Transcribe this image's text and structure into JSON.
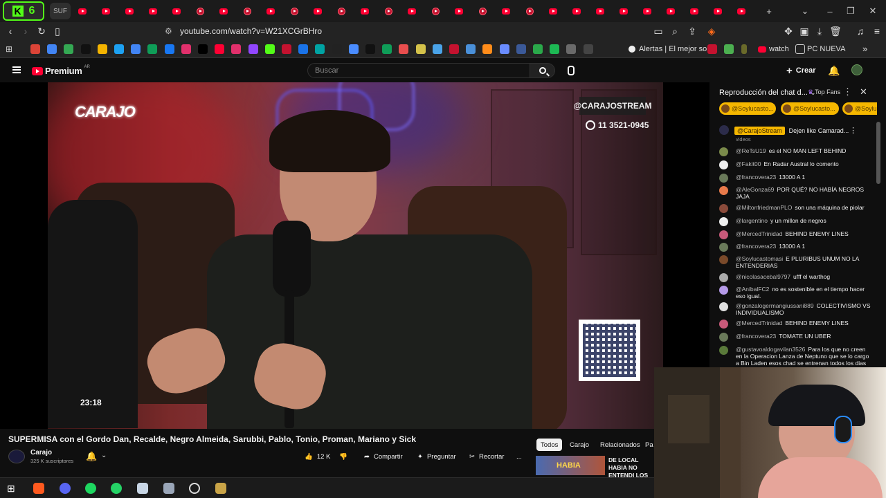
{
  "browser": {
    "kick_ext": {
      "letter": "K",
      "count": "6"
    },
    "active_tab_label": "SUF",
    "tab_favicon_count": 29,
    "url": "youtube.com/watch?v=W21XCGrBHro",
    "bookmarks": {
      "alertas": "Alertas | El mejor so...",
      "watch": "watch",
      "pc_nueva": "PC NUEVA"
    }
  },
  "youtube": {
    "logo_word": "Premium",
    "country": "AR",
    "search_placeholder": "Buscar",
    "create_label": "Crear"
  },
  "video": {
    "overlay_logo": "CARAJO",
    "handle_tag": "@CARAJOSTREAM",
    "phone_tag": "11 3521-0945",
    "timer": "23:18",
    "title": "SUPERMISA con el Gordo Dan, Recalde, Negro Almeida, Sarubbi, Pablo, Tonio, Proman, Mariano y Sick",
    "channel": "Carajo",
    "subscribers": "325 K suscriptores",
    "likes": "12 K",
    "share": "Compartir",
    "ask": "Preguntar",
    "clip": "Recortar",
    "more": "..."
  },
  "filters": [
    "Todos",
    "Carajo",
    "Relacionados",
    "Pa"
  ],
  "recommended": {
    "title": "DE LOCAL HABIA NO ENTENDI LOS",
    "thumb_text": "HABIA"
  },
  "chat": {
    "title": "Reproducción del chat d...",
    "top_fans": "Top Fans",
    "pills": [
      "@Soylucasto...",
      "@Soylucasto...",
      "@Soylu"
    ],
    "pinned": {
      "author": "@CarajoStream",
      "text": "Dejen like Camarad..."
    },
    "partial_word": "videos",
    "messages": [
      {
        "author": "@ReTsU19",
        "text": "es el NO MAN LEFT BEHIND",
        "color": "#7a8a4a"
      },
      {
        "author": "@Fakit00",
        "text": "En Radar Austral lo comento",
        "color": "#eeeeee"
      },
      {
        "author": "@francovera23",
        "text": "13000 A 1",
        "color": "#6a7a5a"
      },
      {
        "author": "@AleGonza69",
        "text": "POR QUÉ? NO HABÍA NEGROS JAJA",
        "color": "#e87a4a"
      },
      {
        "author": "@MiltonfriedmanPLO",
        "text": "son una máquina de piolar",
        "color": "#8a4a3a"
      },
      {
        "author": "@largentino",
        "text": "y un millon de negros",
        "color": "#eeeeee"
      },
      {
        "author": "@MercedTrinidad",
        "text": "BEHIND ENEMY LINES",
        "color": "#c85a7a"
      },
      {
        "author": "@francovera23",
        "text": "13000 A 1",
        "color": "#6a7a5a"
      },
      {
        "author": "@Soylucastomasi",
        "text": "E PLURIBUS UNUM NO LA ENTENDERIAS",
        "color": "#7a4a2a"
      },
      {
        "author": "@nicolasacebal9797",
        "text": "ufff el warthog",
        "color": "#aaaaaa"
      },
      {
        "author": "@AnibalFC2",
        "text": "no es sostenible en el tiempo hacer eso igual.",
        "color": "#b59ae8"
      },
      {
        "author": "@gonzalogermangiussani889",
        "text": "COLECTIVISMO VS INDIVIDUALISMO",
        "color": "#e0e0e0"
      },
      {
        "author": "@MercedTrinidad",
        "text": "BEHIND ENEMY LINES",
        "color": "#c85a7a"
      },
      {
        "author": "@francovera23",
        "text": "TOMATE UN UBER",
        "color": "#6a7a5a"
      },
      {
        "author": "@gustavoaldogavilan3526",
        "text": "Para los que no creen en la Operacion Lanza de Neptuno que se lo cargo a Bin Laden esos chad se entrenan todos los dias para ...",
        "color": "#5a7a3a"
      }
    ]
  }
}
